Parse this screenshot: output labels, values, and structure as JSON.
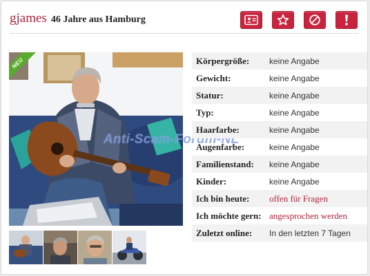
{
  "profile": {
    "username": "gjames",
    "tagline": "46 Jahre aus Hamburg",
    "new_badge": "NEU"
  },
  "actions": [
    {
      "icon": "profile-card-icon"
    },
    {
      "icon": "star-icon"
    },
    {
      "icon": "block-icon"
    },
    {
      "icon": "exclamation-icon"
    }
  ],
  "watermark": "Anti-Scam-Forum-NL",
  "details": [
    {
      "label": "Körpergröße:",
      "value": "keine Angabe"
    },
    {
      "label": "Gewicht:",
      "value": "keine Angabe"
    },
    {
      "label": "Statur:",
      "value": "keine Angabe"
    },
    {
      "label": "Typ:",
      "value": "keine Angabe"
    },
    {
      "label": "Haarfarbe:",
      "value": "keine Angabe"
    },
    {
      "label": "Augenfarbe:",
      "value": "keine Angabe"
    },
    {
      "label": "Familienstand:",
      "value": "keine Angabe"
    },
    {
      "label": "Kinder:",
      "value": "keine Angabe"
    },
    {
      "label": "Ich bin heute:",
      "value": "offen für Fragen"
    },
    {
      "label": "Ich möchte gern:",
      "value": "angesprochen werden"
    },
    {
      "label": "Zuletzt online:",
      "value": "In den letzten 7 Tagen"
    }
  ],
  "colors": {
    "accent": "#b0243c",
    "button": "#c8243d",
    "badge": "#58ab2c"
  }
}
